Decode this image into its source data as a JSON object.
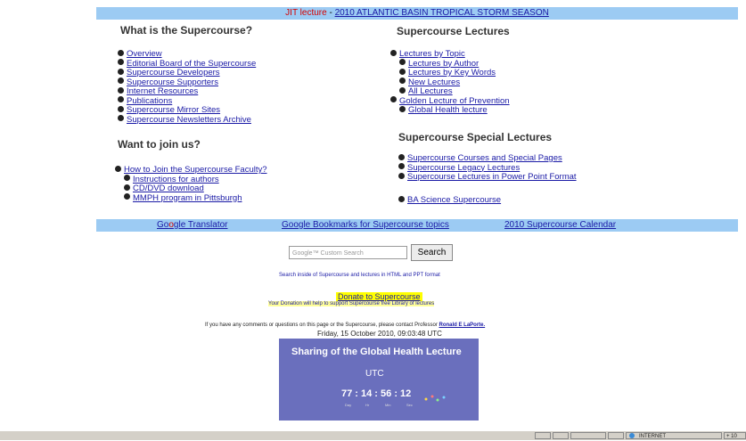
{
  "top_bar": {
    "prefix": "JIT lecture",
    "separator": " - ",
    "link": "2010 ATLANTIC BASIN TROPICAL STORM SEASON"
  },
  "what_is": {
    "heading": "What is the Supercourse?",
    "items": [
      "Overview",
      "Editorial Board of the Supercourse",
      "Supercourse Developers",
      "Supercourse Supporters",
      "Internet Resources",
      "Publications",
      "Supercourse Mirror Sites",
      "Supercourse Newsletters Archive"
    ]
  },
  "join": {
    "heading": "Want to join us?",
    "main": "How to Join the Supercourse Faculty?",
    "subs": [
      "Instructions for authors",
      "CD/DVD download",
      "MMPH program in Pittsburgh"
    ]
  },
  "lectures": {
    "heading": "Supercourse Lectures",
    "topic": "Lectures by Topic",
    "subs": [
      "Lectures by Author",
      "Lectures by Key Words",
      "New Lectures",
      "All Lectures"
    ],
    "golden": "Golden Lecture of Prevention",
    "global": "Global Health lecture"
  },
  "special": {
    "heading": "Supercourse Special Lectures",
    "items": [
      "Supercourse Courses and Special Pages",
      "Supercourse Legacy Lectures",
      "Supercourse Lectures in Power Point Format"
    ],
    "ba": "BA Science Supercourse"
  },
  "bottom_bar": {
    "translator_go": "Go",
    "translator_o": "o",
    "translator_rest": "gle Translator",
    "bookmarks": "Google Bookmarks for Supercourse topics",
    "calendar": "2010 Supercourse Calendar"
  },
  "search": {
    "placeholder_brand": "Google™",
    "placeholder": "Custom Search",
    "button": "Search",
    "caption": "Search inside of Supercourse and lectures in HTML and PPT format"
  },
  "donate": {
    "link": "Donate to Supercourse",
    "sub": "Your Donation will help to support Supercourse free Library of lectures"
  },
  "contact": {
    "text": "If you have any comments or questions on this page or the Supercourse, please contact Professor ",
    "name": "Ronald E LaPorte."
  },
  "date": "Friday, 15 October 2010, 09:03:48 UTC",
  "widget": {
    "title": "Sharing of the Global Health Lecture",
    "utc": "UTC",
    "clock": "77 : 14 : 56 : 12",
    "labels": [
      "Day",
      "Hr",
      "Min",
      "Sec"
    ]
  },
  "taskbar": {
    "net": "INTERNET",
    "zoom": "+ 10"
  },
  "colors": {
    "bar": "#9ccbf3",
    "link": "#1a1aa6",
    "widget": "#6a6fbd"
  }
}
